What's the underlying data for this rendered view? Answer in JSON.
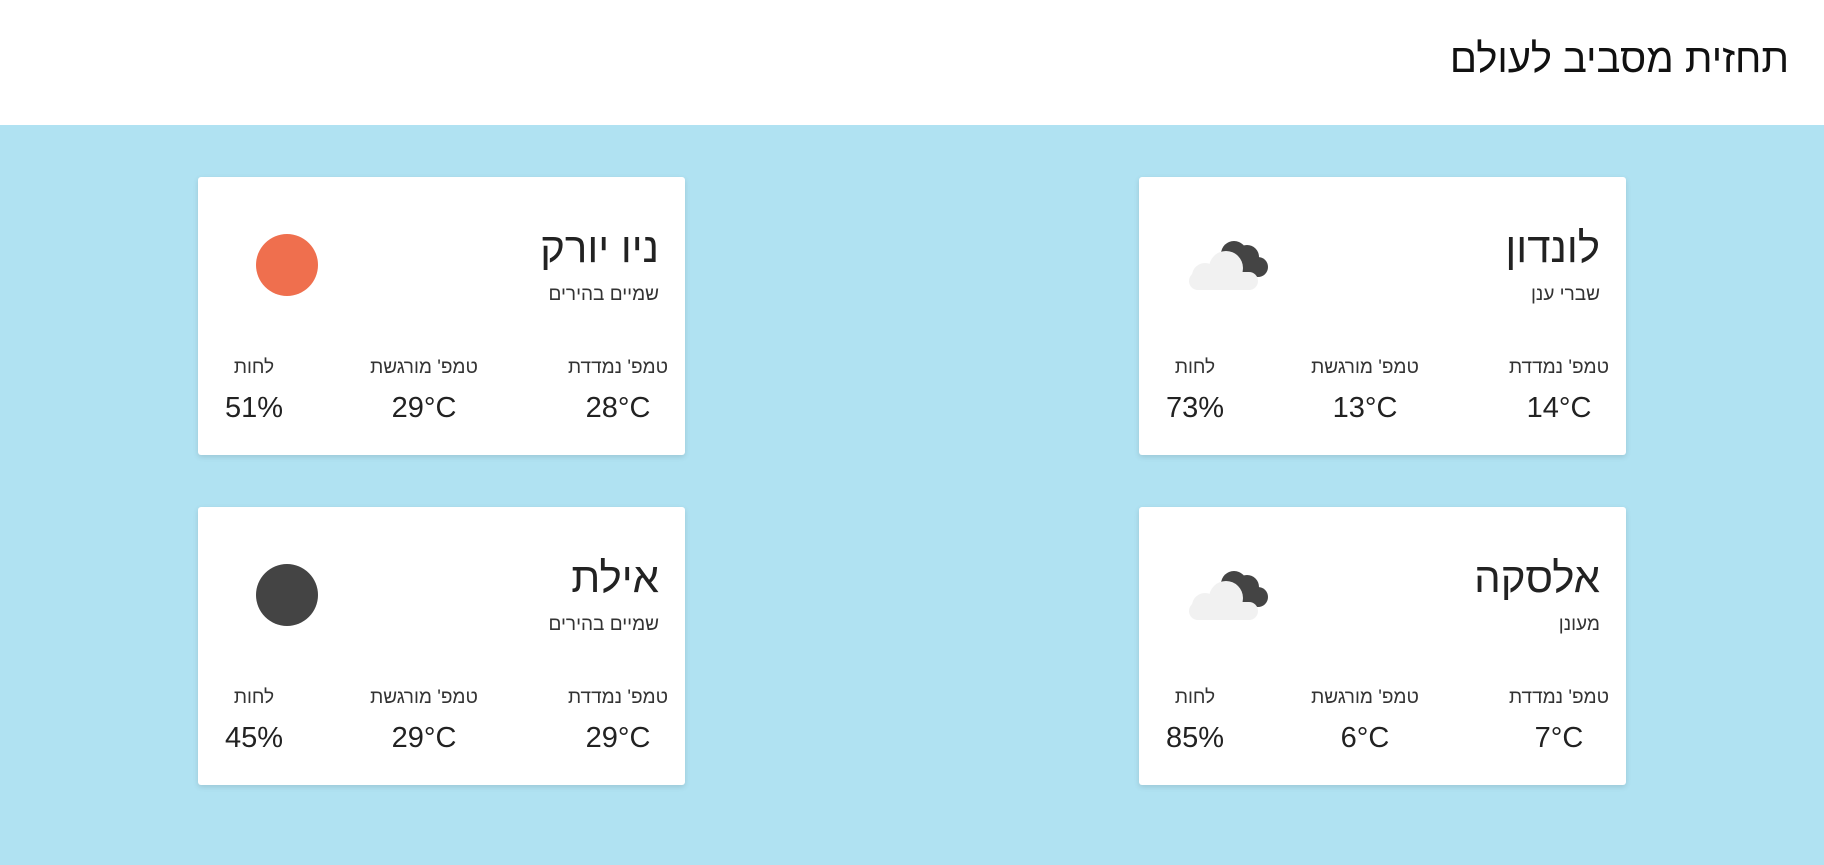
{
  "page_title": "תחזית מסביב לעולם",
  "colors": {
    "background": "#b0e2f2",
    "header": "#ffffff",
    "card": "#ffffff",
    "sun": "#ef6f4e",
    "moon": "#444444",
    "cloud_light": "#f1f1f1",
    "cloud_dark": "#444444"
  },
  "labels": {
    "measured": "טמפ' נמדדת",
    "feels_like": "טמפ' מורגשת",
    "humidity": "לחות"
  },
  "cities": {
    "london": {
      "name": "לונדון",
      "condition": "שברי ענן",
      "icon": "cloud-icon",
      "measured": "14°C",
      "feels_like": "13°C",
      "humidity": "73%"
    },
    "new_york": {
      "name": "ניו יורק",
      "condition": "שמיים בהירים",
      "icon": "sun-icon",
      "measured": "28°C",
      "feels_like": "29°C",
      "humidity": "51%"
    },
    "alaska": {
      "name": "אלסקה",
      "condition": "מעונן",
      "icon": "cloud-icon",
      "measured": "7°C",
      "feels_like": "6°C",
      "humidity": "85%"
    },
    "eilat": {
      "name": "אילת",
      "condition": "שמיים בהירים",
      "icon": "moon-icon",
      "measured": "29°C",
      "feels_like": "29°C",
      "humidity": "45%"
    }
  }
}
